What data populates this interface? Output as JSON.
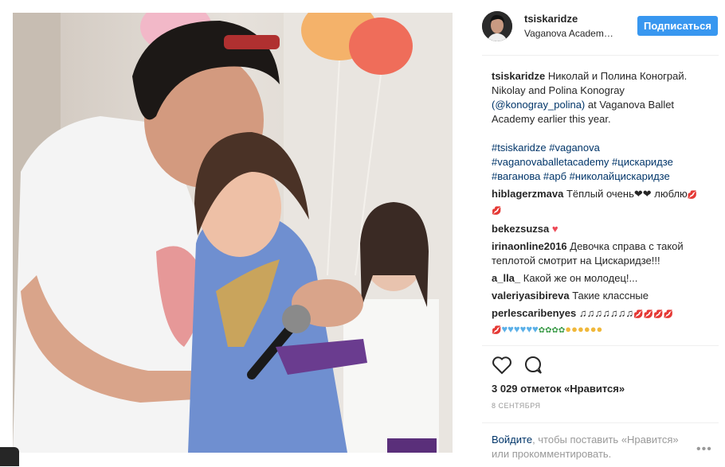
{
  "post": {
    "username": "tsiskaridze",
    "location": "Vaganova Academ…",
    "follow_label": "Подписаться",
    "caption_user": "tsiskaridze",
    "caption_before": " Николай и Полина Конограй. Nikolay and Polina Konogray ",
    "caption_link": "(@konogray_polina)",
    "caption_after": " at Vaganova Ballet Academy earlier this year.",
    "hashtags": "#tsiskaridze #vaganova #vaganovaballetacademy #цискаридзе #ваганова #арб #николайцискаридзе",
    "likes": "3 029 отметок «Нравится»",
    "date": "8 СЕНТЯБРЯ"
  },
  "comments": [
    {
      "user": "hiblagerzmava",
      "text": " Тёплый очень❤❤ люблю"
    },
    {
      "user": "bekezsuzsa",
      "text": " "
    },
    {
      "user": "irinaonline2016",
      "text": " Девочка справа с такой теплотой смотрит на Цискаридзе!!!"
    },
    {
      "user": "a_lla_",
      "text": " Какой же он молодец!..."
    },
    {
      "user": "valeriyasibireva",
      "text": " Такие классные"
    },
    {
      "user": "perlescaribenyes",
      "text": " ♫♫♫♫♫♫♫"
    }
  ],
  "login_prompt": {
    "link": "Войдите",
    "text": ", чтобы поставить «Нравится» или прокомментировать."
  },
  "more_label": "•••",
  "icons": {
    "like": "heart-outline-icon",
    "comment": "comment-bubble-icon",
    "more": "ellipsis-icon"
  },
  "colors": {
    "follow_button": "#3897f0",
    "link": "#003569",
    "muted": "#999999",
    "heart": "#ed4956"
  }
}
